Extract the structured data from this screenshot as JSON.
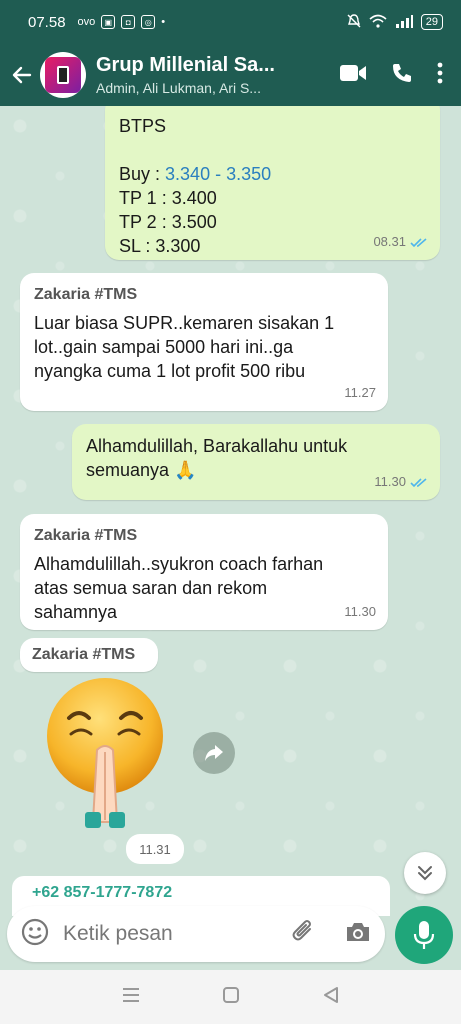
{
  "status_bar": {
    "time": "07.58",
    "notif_icons": [
      "ovo-icon",
      "jago-icon",
      "shopee-icon",
      "app-icon"
    ],
    "battery": "29"
  },
  "header": {
    "title": "Grup Millenial Sa...",
    "subtitle": "Admin, Ali Lukman, Ari S..."
  },
  "messages": [
    {
      "id": "m1",
      "direction": "out",
      "lines": [
        "BTPS",
        "",
        "Buy : ",
        "TP 1 : 3.400",
        "TP 2 : 3.500",
        "SL : 3.300"
      ],
      "buy_range": "3.340 - 3.350",
      "time": "08.31",
      "read": true
    },
    {
      "id": "m2",
      "direction": "in",
      "sender": "Zakaria #TMS",
      "lines": [
        "Luar biasa SUPR..kemaren sisakan 1",
        "lot..gain sampai 5000 hari ini..ga",
        "nyangka cuma 1 lot profit 500 ribu"
      ],
      "time": "11.27"
    },
    {
      "id": "m3",
      "direction": "out",
      "lines": [
        "Alhamdulillah, Barakallahu untuk",
        "semuanya 🙏"
      ],
      "time": "11.30",
      "read": true
    },
    {
      "id": "m4",
      "direction": "in",
      "sender": "Zakaria #TMS",
      "lines": [
        "Alhamdulillah..syukron coach farhan",
        "atas semua saran dan rekom",
        "sahamnya"
      ],
      "time": "11.30"
    },
    {
      "id": "m5",
      "direction": "in",
      "sender": "Zakaria #TMS",
      "sticker": "praying-emoji-sticker",
      "time": "11.31"
    }
  ],
  "peek_sender": "+62 857-1777-7872",
  "composer": {
    "placeholder": "Ketik pesan"
  },
  "colors": {
    "header": "#1f5c52",
    "outgoing_bubble": "#e3f7c6",
    "incoming_bubble": "#ffffff",
    "link_blue": "#2a7fbf",
    "mic_green": "#1fa67a",
    "read_ticks": "#4fb6ec"
  }
}
